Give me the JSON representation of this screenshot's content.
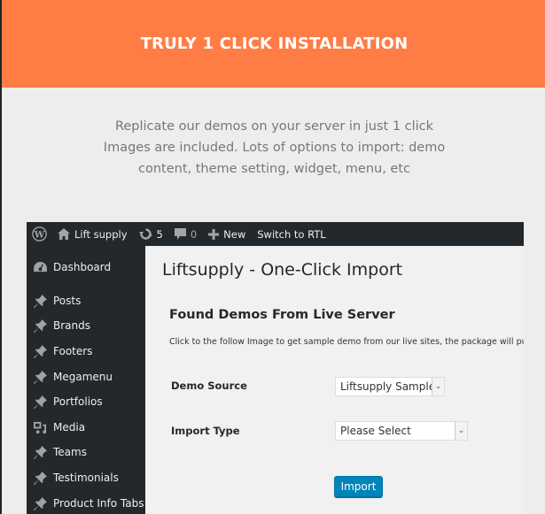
{
  "hero": {
    "title": "TRULY 1 CLICK INSTALLATION",
    "bg_color": "#ff7d45"
  },
  "intro": {
    "lines": [
      "Replicate our demos on your server in just 1 click",
      "Images are included. Lots of options to import: demo",
      "content, theme setting, widget, menu, etc"
    ]
  },
  "adminbar": {
    "site_name": "Lift supply",
    "updates_count": "5",
    "comments_count": "0",
    "new_label": "New",
    "rtl_label": "Switch to RTL"
  },
  "sidebar": {
    "items": [
      {
        "label": "Dashboard",
        "icon": "dashboard-icon"
      },
      {
        "label": "Posts",
        "icon": "pin-icon"
      },
      {
        "label": "Brands",
        "icon": "pin-icon"
      },
      {
        "label": "Footers",
        "icon": "pin-icon"
      },
      {
        "label": "Megamenu",
        "icon": "pin-icon"
      },
      {
        "label": "Portfolios",
        "icon": "pin-icon"
      },
      {
        "label": "Media",
        "icon": "media-icon"
      },
      {
        "label": "Teams",
        "icon": "pin-icon"
      },
      {
        "label": "Testimonials",
        "icon": "pin-icon"
      },
      {
        "label": "Product Info Tabs",
        "icon": "pin-icon"
      }
    ]
  },
  "main": {
    "page_title": "Liftsupply - One-Click Import",
    "section_title": "Found Demos From Live Server",
    "description": "Click to the follow Image to get sample demo from our live sites, the package will put",
    "demo_source": {
      "label": "Demo Source",
      "value": "Liftsupply Sample"
    },
    "import_type": {
      "label": "Import Type",
      "value": "Please Select"
    },
    "import_button": "Import"
  }
}
